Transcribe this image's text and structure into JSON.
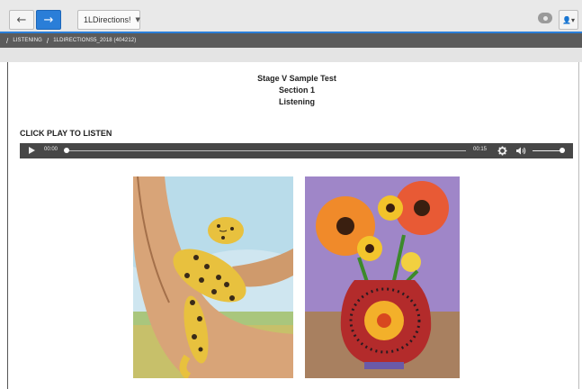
{
  "toolbar": {
    "back_icon": "arrow-left-icon",
    "forward_icon": "arrow-right-icon",
    "dropdown_value": "1LDirections!",
    "view_icon": "eye-icon",
    "user_icon": "user-icon"
  },
  "breadcrumb": {
    "items": [
      "LISTENING",
      "1LDIRECTIONS5_2018 (404212)"
    ]
  },
  "content": {
    "title": "Stage V Sample Test",
    "section": "Section 1",
    "subtitle": "Listening",
    "instruction": "CLICK PLAY TO LISTEN"
  },
  "player": {
    "current_time": "00:00",
    "duration": "00:15",
    "progress": 0,
    "volume": 0.9
  },
  "images": [
    {
      "name": "leopard-in-tree-painting"
    },
    {
      "name": "sunflowers-in-vase-painting"
    }
  ],
  "colors": {
    "accent": "#2a7ed8",
    "breadcrumb_bg": "#5b5b5b",
    "player_bg": "#474747"
  }
}
